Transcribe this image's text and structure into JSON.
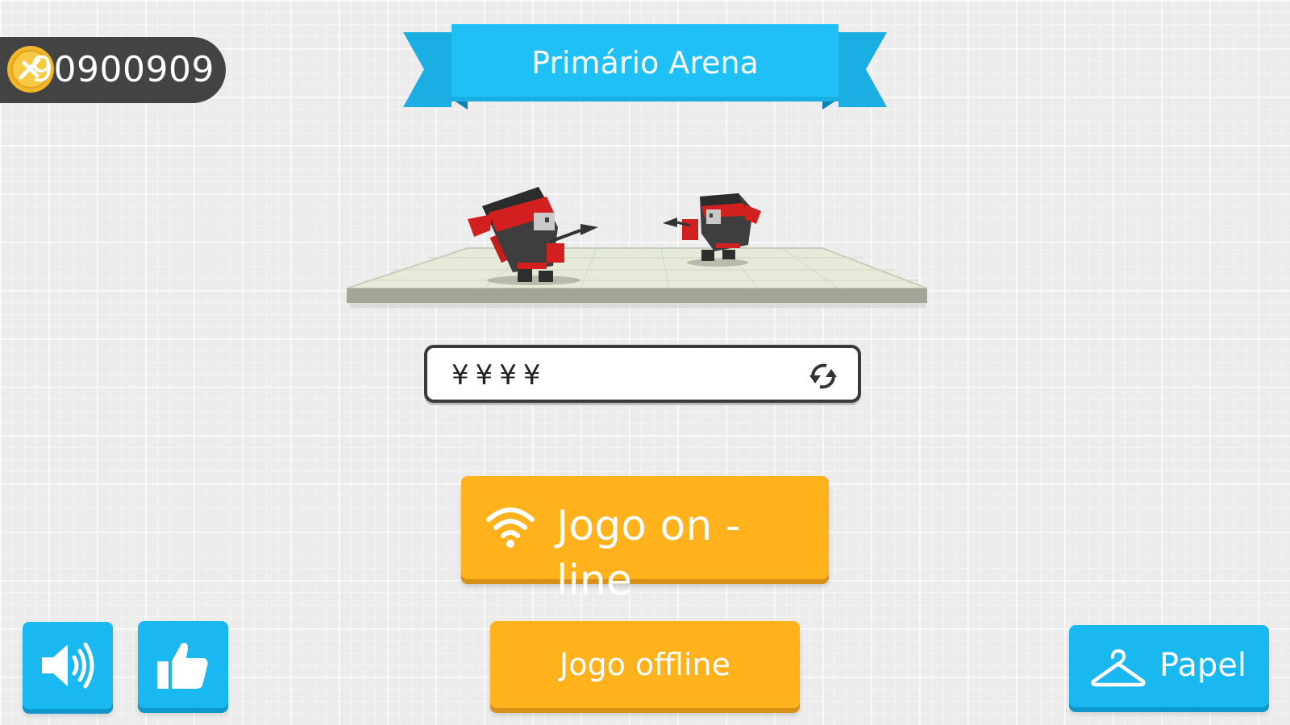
{
  "coins": {
    "icon": "gold-coin-icon",
    "count": "90900909"
  },
  "banner": {
    "title": "Primário Arena",
    "color": "#1ec0f5"
  },
  "arena": {
    "players": [
      "ninja-player-icon",
      "ninja-opponent-icon"
    ]
  },
  "name_field": {
    "value": "¥¥¥¥",
    "refresh_icon": "refresh-arrows-icon"
  },
  "buttons": {
    "online": {
      "label": "Jogo on - line",
      "icon": "wifi-icon"
    },
    "offline": {
      "label": "Jogo offline"
    },
    "sound": {
      "icon": "speaker-icon"
    },
    "like": {
      "icon": "thumbs-up-icon"
    },
    "role": {
      "label": "Papel",
      "icon": "hanger-icon"
    }
  },
  "colors": {
    "orange": "#ffb21b",
    "blue": "#1ab8f1",
    "dark": "#3b3b3b"
  }
}
